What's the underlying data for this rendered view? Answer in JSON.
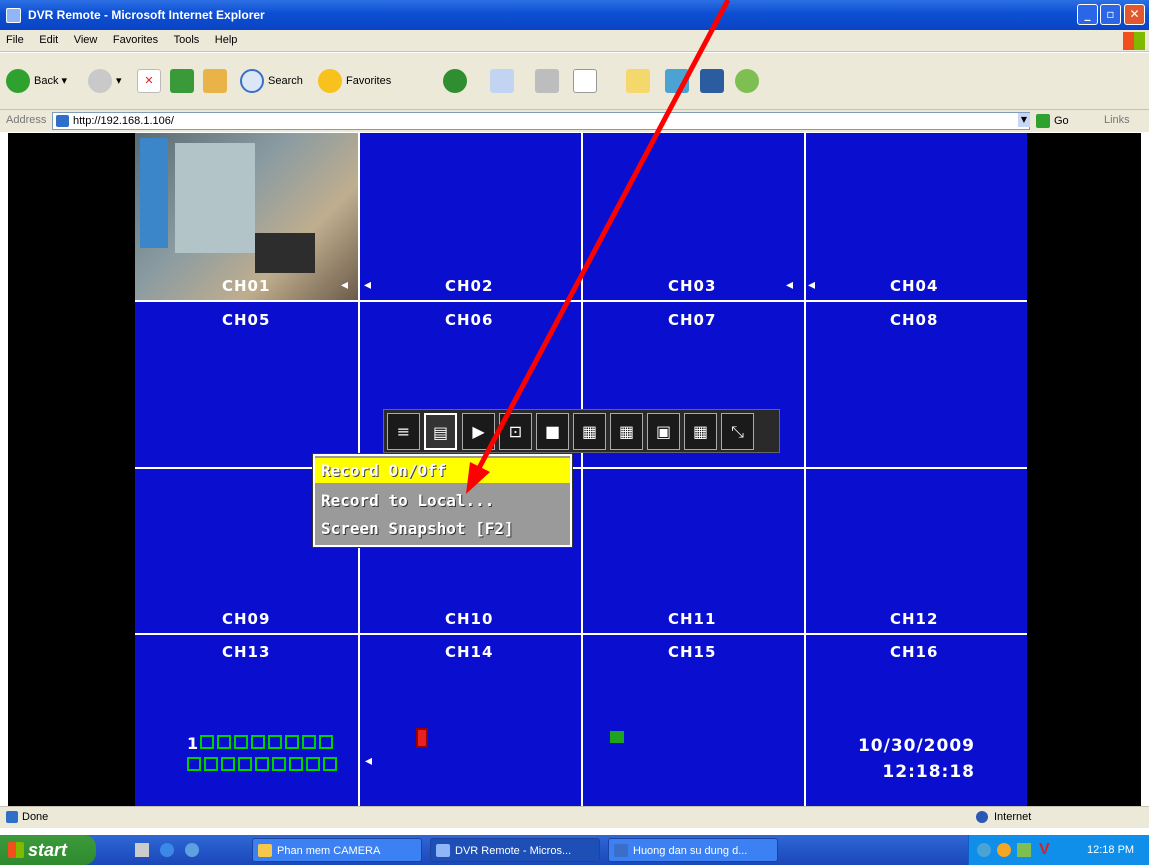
{
  "window": {
    "title": "DVR Remote - Microsoft Internet Explorer"
  },
  "menubar": {
    "items": [
      "File",
      "Edit",
      "View",
      "Favorites",
      "Tools",
      "Help"
    ]
  },
  "toolbar": {
    "back": "Back",
    "search": "Search",
    "favorites": "Favorites"
  },
  "address": {
    "label": "Address",
    "url": "http://192.168.1.106/",
    "go": "Go",
    "links": "Links"
  },
  "channels": [
    "CH01",
    "CH02",
    "CH03",
    "CH04",
    "CH05",
    "CH06",
    "CH07",
    "CH08",
    "CH09",
    "CH10",
    "CH11",
    "CH12",
    "CH13",
    "CH14",
    "CH15",
    "CH16"
  ],
  "context_menu": {
    "items": [
      "Record On/Off",
      "Record to Local...",
      "Screen Snapshot [F2]"
    ]
  },
  "dvr": {
    "record_index": "1",
    "date": "10/30/2009",
    "time": "12:18:18"
  },
  "status": {
    "left": "Done",
    "zone": "Internet"
  },
  "taskbar": {
    "start": "start",
    "tasks": [
      "Phan mem CAMERA",
      "DVR Remote - Micros...",
      "Huong dan su dung d..."
    ],
    "clock": "12:18 PM"
  },
  "colors": {
    "dvr_blue": "#0a0ecf",
    "highlight": "#ffff00",
    "arrow": "#ff0000"
  }
}
